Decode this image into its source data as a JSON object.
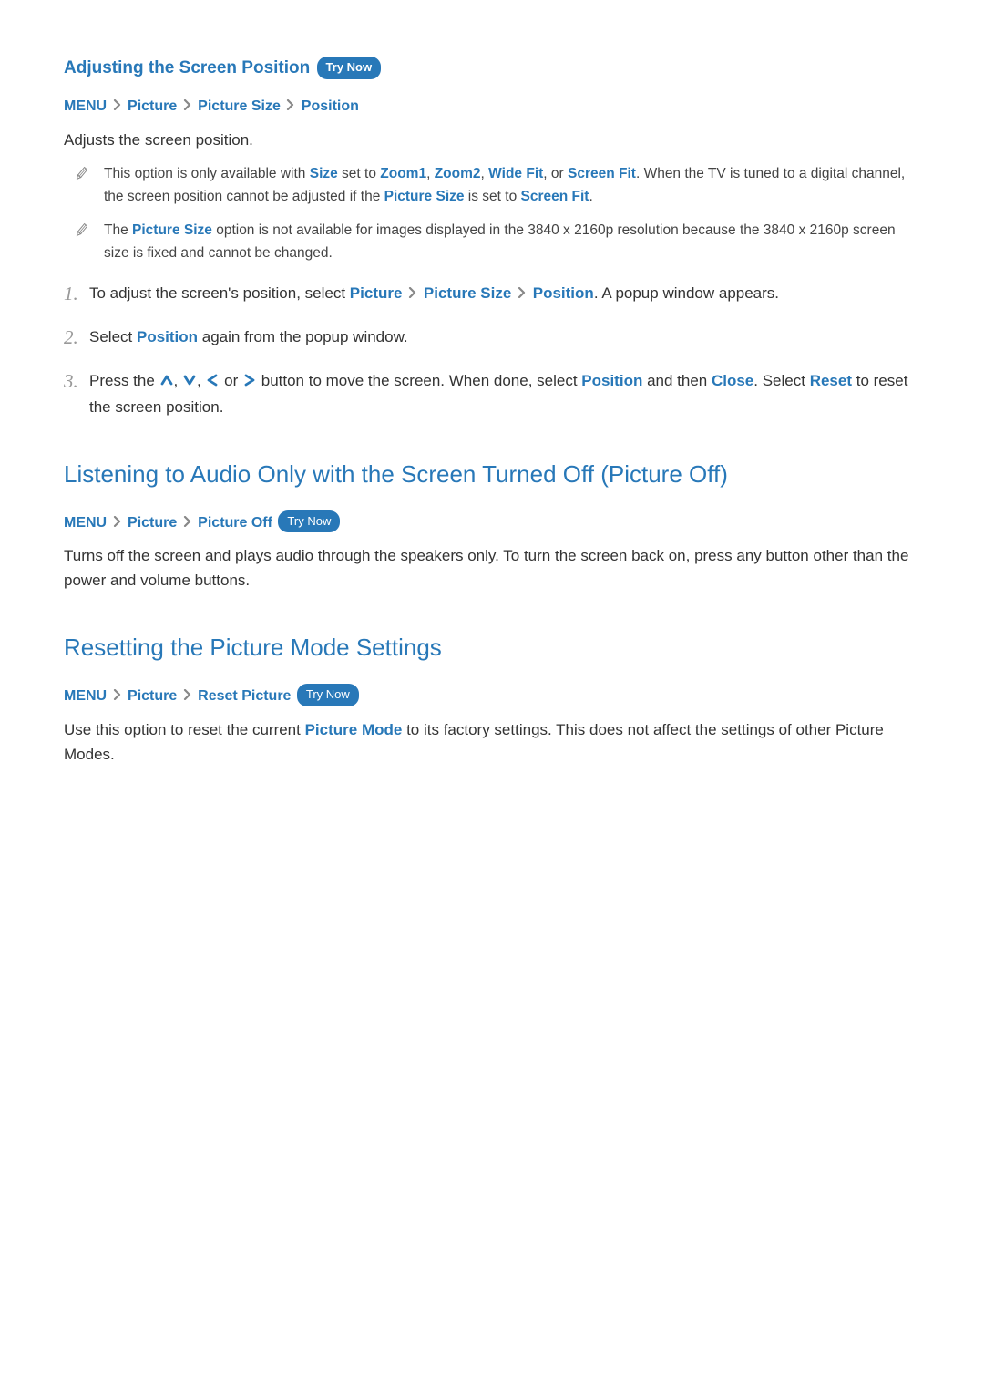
{
  "try_now_label": "Try Now",
  "section1": {
    "heading": "Adjusting the Screen Position",
    "breadcrumb": [
      "MENU",
      "Picture",
      "Picture Size",
      "Position"
    ],
    "intro": "Adjusts the screen position.",
    "notes": [
      {
        "parts": [
          {
            "t": "This option is only available with "
          },
          {
            "t": "Size",
            "link": true
          },
          {
            "t": " set to "
          },
          {
            "t": "Zoom1",
            "link": true
          },
          {
            "t": ", "
          },
          {
            "t": "Zoom2",
            "link": true
          },
          {
            "t": ", "
          },
          {
            "t": "Wide Fit",
            "link": true
          },
          {
            "t": ", or "
          },
          {
            "t": "Screen Fit",
            "link": true
          },
          {
            "t": ". When the TV is tuned to a digital channel, the screen position cannot be adjusted if the "
          },
          {
            "t": "Picture Size",
            "link": true
          },
          {
            "t": " is set to "
          },
          {
            "t": "Screen Fit",
            "link": true
          },
          {
            "t": "."
          }
        ]
      },
      {
        "parts": [
          {
            "t": "The "
          },
          {
            "t": "Picture Size",
            "link": true
          },
          {
            "t": " option is not available for images displayed in the 3840 x 2160p resolution because the 3840 x 2160p screen size is fixed and cannot be changed."
          }
        ]
      }
    ],
    "steps": [
      {
        "num": "1.",
        "parts": [
          {
            "t": "To adjust the screen's position, select "
          },
          {
            "t": "Picture",
            "link": true
          },
          {
            "chev": true
          },
          {
            "t": "Picture Size",
            "link": true
          },
          {
            "chev": true
          },
          {
            "t": "Position",
            "link": true
          },
          {
            "t": ". A popup window appears."
          }
        ]
      },
      {
        "num": "2.",
        "parts": [
          {
            "t": "Select "
          },
          {
            "t": "Position",
            "link": true
          },
          {
            "t": " again from the popup window."
          }
        ]
      },
      {
        "num": "3.",
        "parts": [
          {
            "t": "Press the "
          },
          {
            "arrow": "up"
          },
          {
            "t": ", "
          },
          {
            "arrow": "down"
          },
          {
            "t": ", "
          },
          {
            "arrow": "left"
          },
          {
            "t": " or "
          },
          {
            "arrow": "right"
          },
          {
            "t": " button to move the screen. When done, select "
          },
          {
            "t": "Position",
            "link": true
          },
          {
            "t": " and then "
          },
          {
            "t": "Close",
            "link": true
          },
          {
            "t": ". Select "
          },
          {
            "t": "Reset",
            "link": true
          },
          {
            "t": " to reset the screen position."
          }
        ]
      }
    ]
  },
  "section2": {
    "heading": "Listening to Audio Only with the Screen Turned Off (Picture Off)",
    "breadcrumb": [
      "MENU",
      "Picture",
      "Picture Off"
    ],
    "body": "Turns off the screen and plays audio through the speakers only. To turn the screen back on, press any button other than the power and volume buttons."
  },
  "section3": {
    "heading": "Resetting the Picture Mode Settings",
    "breadcrumb": [
      "MENU",
      "Picture",
      "Reset Picture"
    ],
    "body_parts": [
      {
        "t": "Use this option to reset the current "
      },
      {
        "t": "Picture Mode",
        "link": true
      },
      {
        "t": " to its factory settings. This does not affect the settings of other Picture Modes."
      }
    ]
  }
}
